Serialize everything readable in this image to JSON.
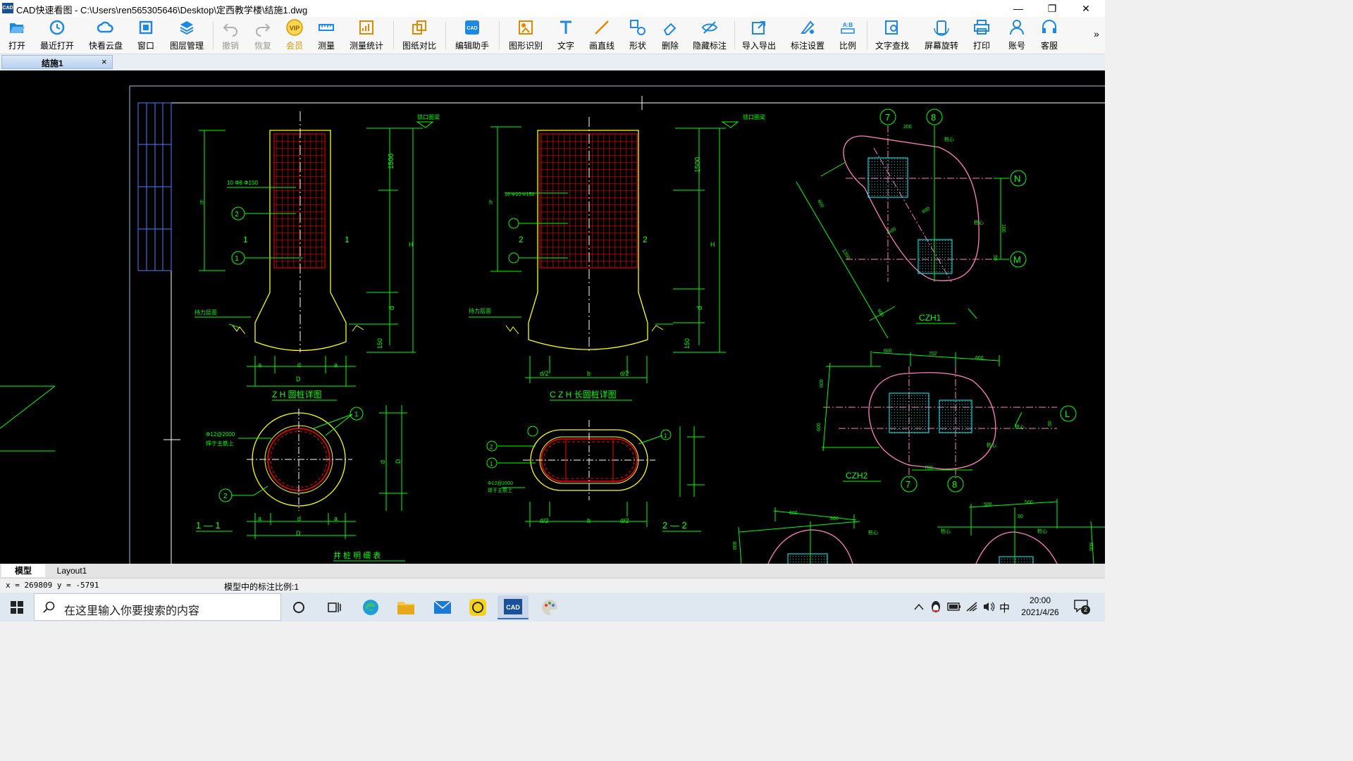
{
  "window": {
    "app_icon_text": "CAD",
    "title": "CAD快速看图 - C:\\Users\\ren565305646\\Desktop\\定西教学楼\\结施1.dwg",
    "minimize": "—",
    "maximize": "❐",
    "close": "✕"
  },
  "toolbar": {
    "items": [
      {
        "label": "打开",
        "icon": "folder-open-icon"
      },
      {
        "label": "最近打开",
        "icon": "history-icon"
      },
      {
        "label": "快看云盘",
        "icon": "cloud-icon"
      },
      {
        "label": "窗口",
        "icon": "window-frame-icon"
      },
      {
        "label": "图层管理",
        "icon": "layers-icon"
      },
      {
        "label": "撤销",
        "icon": "undo-icon"
      },
      {
        "label": "恢复",
        "icon": "redo-icon"
      },
      {
        "label": "会员",
        "icon": "vip-icon",
        "icon_text": "VIP"
      },
      {
        "label": "测量",
        "icon": "ruler-icon"
      },
      {
        "label": "测量统计",
        "icon": "measure-stats-icon"
      },
      {
        "label": "图纸对比",
        "icon": "compare-icon"
      },
      {
        "label": "编辑助手",
        "icon": "edit-assistant-icon",
        "icon_text": "CAD"
      },
      {
        "label": "图形识别",
        "icon": "shape-recognition-icon"
      },
      {
        "label": "文字",
        "icon": "text-icon"
      },
      {
        "label": "画直线",
        "icon": "line-icon"
      },
      {
        "label": "形状",
        "icon": "shapes-icon"
      },
      {
        "label": "删除",
        "icon": "eraser-icon"
      },
      {
        "label": "隐藏标注",
        "icon": "hide-annotation-icon"
      },
      {
        "label": "导入导出",
        "icon": "import-export-icon"
      },
      {
        "label": "标注设置",
        "icon": "annotation-settings-icon"
      },
      {
        "label": "比例",
        "icon": "scale-icon",
        "icon_text": "A:B"
      },
      {
        "label": "文字查找",
        "icon": "text-search-icon"
      },
      {
        "label": "屏幕旋转",
        "icon": "rotate-screen-icon"
      },
      {
        "label": "打印",
        "icon": "printer-icon"
      },
      {
        "label": "账号",
        "icon": "user-icon"
      },
      {
        "label": "客服",
        "icon": "headset-icon"
      }
    ],
    "overflow": "»"
  },
  "tabs": {
    "doc_tab": "结施1",
    "close": "×"
  },
  "layout_tabs": [
    "模型",
    "Layout1"
  ],
  "status": {
    "coords": "x = 269809  y = -5791",
    "scale_text": "模型中的标注比例:1"
  },
  "drawing": {
    "labels": {
      "zh_title": "Z H  圆桩详图",
      "czh_title": "C Z H  长圆桩详图",
      "sec1": "1 — 1",
      "sec2": "2 — 2",
      "czh1": "CZH1",
      "czh2": "CZH2",
      "table_title": "井 桩 明 细 表",
      "rebar1": "10 Φ8 Φ150",
      "rebar2": "10 Φ10 Φ150",
      "stirrup1": "Φ12@2000",
      "stirrup1b": "焊于主筋上",
      "stirrup2": "Φ12@2000",
      "stirrup2b": "焊于主筋上",
      "h": "h",
      "H": "H",
      "dim1500": "1500",
      "dim150": "150",
      "d": "d",
      "a": "a",
      "b": "b",
      "D": "D",
      "d2": "d/2",
      "num1": "1",
      "num2": "2",
      "holdbeam": "锁口圈梁",
      "bearing": "持力层面",
      "ax7": "7",
      "ax8": "8",
      "axN": "N",
      "axM": "M",
      "axL": "L",
      "d600": "600",
      "d700": "700",
      "d702": "702",
      "d500": "500",
      "d50": "50",
      "d100": "100",
      "d200": "200",
      "d1200": "1200",
      "d900": "900",
      "center": "桩心"
    }
  },
  "taskbar": {
    "search_placeholder": "在这里输入你要搜索的内容",
    "cad_icon_text": "CAD",
    "ime": "中",
    "time": "20:00",
    "date": "2021/4/26",
    "notif_count": "2"
  },
  "colors": {
    "canvas_bg": "#000000",
    "cad_yellow": "#ffff00",
    "cad_green": "#00ff00",
    "cad_red": "#ff0000",
    "cad_cyan": "#00ffff",
    "cad_pink": "#ff80c0",
    "cad_white": "#ffffff",
    "toolbar_blue": "#1e88e5"
  }
}
